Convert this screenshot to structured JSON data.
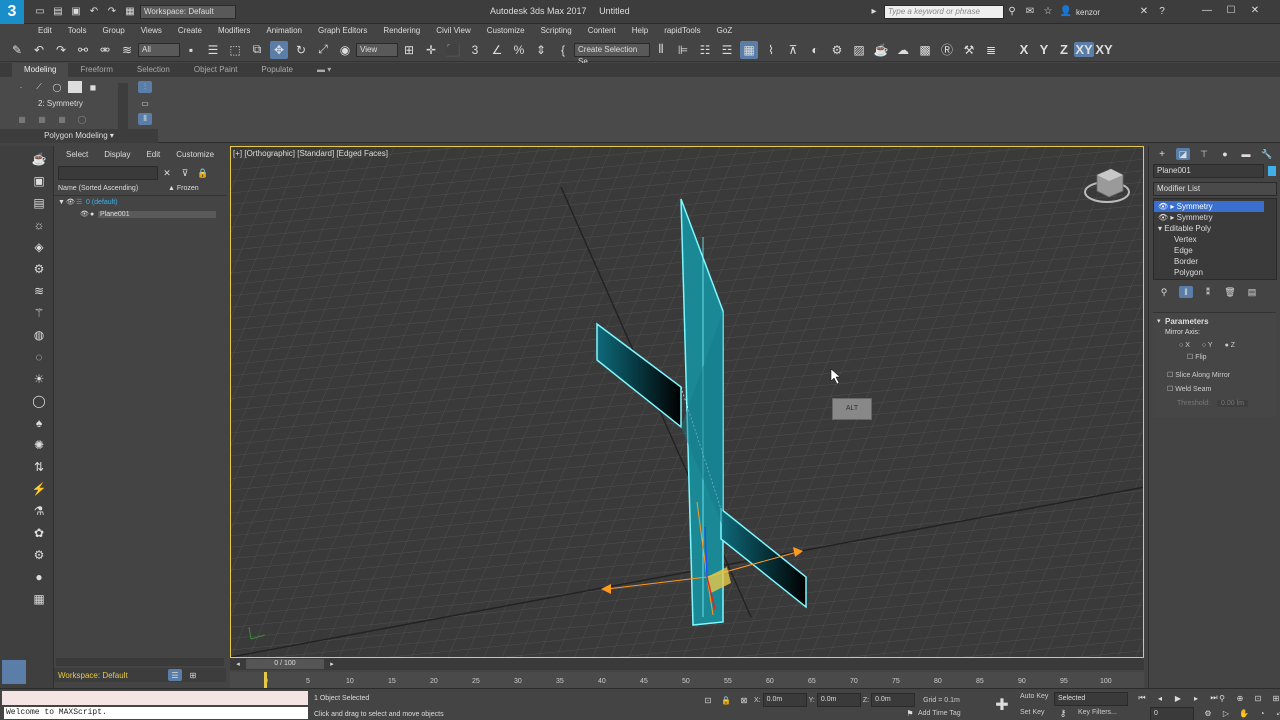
{
  "app": {
    "title": "Autodesk 3ds Max 2017",
    "doc_title": "Untitled",
    "workspace": "Workspace: Default",
    "search_placeholder": "Type a keyword or phrase",
    "user": "kenzor",
    "logo": "3"
  },
  "menu": [
    "Edit",
    "Tools",
    "Group",
    "Views",
    "Create",
    "Modifiers",
    "Animation",
    "Graph Editors",
    "Rendering",
    "Civil View",
    "Customize",
    "Scripting",
    "Content",
    "Help",
    "rapidTools",
    "GoZ"
  ],
  "toolbar": {
    "filter": "All",
    "view_dropdown": "View",
    "selection_set": "Create Selection Se",
    "axis_buttons": [
      "X",
      "Y",
      "Z",
      "XY",
      "XY"
    ]
  },
  "ribbon": {
    "tabs": [
      "Modeling",
      "Freeform",
      "Selection",
      "Object Paint",
      "Populate"
    ],
    "modifier_label": "2: Symmetry",
    "panel_label": "Polygon Modeling"
  },
  "explorer": {
    "menus": [
      "Select",
      "Display",
      "Edit",
      "Customize"
    ],
    "col_name": "Name (Sorted Ascending)",
    "col_frozen": "▲ Frozen",
    "layer": "0 (default)",
    "object": "Plane001",
    "workspace_footer": "Workspace: Default"
  },
  "viewport": {
    "label": "[+] [Orthographic] [Standard] [Edged Faces]",
    "alt_label": "ALT"
  },
  "cmdpanel": {
    "object_name": "Plane001",
    "modifier_list_label": "Modifier List",
    "stack": [
      "Symmetry",
      "Symmetry",
      "Editable Poly",
      "Vertex",
      "Edge",
      "Border",
      "Polygon"
    ],
    "params_title": "Parameters",
    "mirror_axis": "Mirror Axis:",
    "axes": [
      "X",
      "Y",
      "Z"
    ],
    "flip": "Flip",
    "slice": "Slice Along Mirror",
    "weld": "Weld Seam",
    "threshold": "Threshold:",
    "threshold_value": "0.00 lm"
  },
  "timeline": {
    "frame": "0 / 100",
    "ticks": [
      "0",
      "5",
      "10",
      "15",
      "20",
      "25",
      "30",
      "35",
      "40",
      "45",
      "50",
      "55",
      "60",
      "65",
      "70",
      "75",
      "80",
      "85",
      "90",
      "95",
      "100"
    ]
  },
  "status": {
    "maxscript": "Welcome to MAXScript.",
    "selected": "1 Object Selected",
    "prompt": "Click and drag to select and move objects",
    "x_label": "X:",
    "x_val": "0.0m",
    "y_label": "Y:",
    "y_val": "0.0m",
    "z_label": "Z:",
    "z_val": "0.0m",
    "grid": "Grid = 0.1m",
    "auto_key": "Auto Key",
    "selected_dd": "Selected",
    "set_key": "Set Key",
    "key_filters": "Key Filters...",
    "add_time_tag": "Add Time Tag",
    "frame_field": "0"
  }
}
